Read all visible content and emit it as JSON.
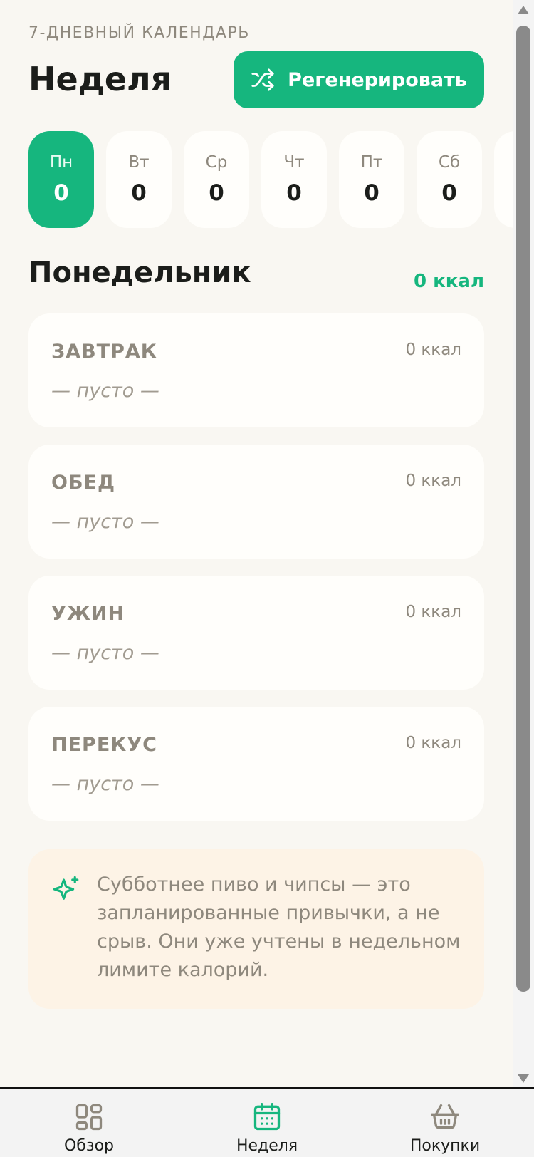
{
  "header": {
    "kicker": "7-ДНЕВНЫЙ КАЛЕНДАРЬ",
    "title": "Неделя",
    "regenerate_label": "Регенерировать"
  },
  "days": [
    {
      "label": "Пн",
      "value": "0",
      "active": true
    },
    {
      "label": "Вт",
      "value": "0"
    },
    {
      "label": "Ср",
      "value": "0"
    },
    {
      "label": "Чт",
      "value": "0"
    },
    {
      "label": "Пт",
      "value": "0"
    },
    {
      "label": "Сб",
      "value": "0"
    }
  ],
  "selected_day": {
    "title": "Понедельник",
    "total": "0 ккал"
  },
  "meals": [
    {
      "name": "ЗАВТРАК",
      "kcal": "0 ккал",
      "empty": "— пусто —"
    },
    {
      "name": "ОБЕД",
      "kcal": "0 ккал",
      "empty": "— пусто —"
    },
    {
      "name": "УЖИН",
      "kcal": "0 ккал",
      "empty": "— пусто —"
    },
    {
      "name": "ПЕРЕКУС",
      "kcal": "0 ккал",
      "empty": "— пусто —"
    }
  ],
  "tip": {
    "icon": "sparkles-icon",
    "text": "Субботнее пиво и чипсы — это запланированные привычки, а не срыв. Они уже учтены в недельном лимите калорий."
  },
  "tabbar": {
    "overview_label": "Обзор",
    "week_label": "Неделя",
    "shopping_label": "Покупки"
  },
  "colors": {
    "accent": "#16b67e",
    "background": "#f9f7f2",
    "card": "#fffefb",
    "tip_background": "#fdf3e6",
    "muted_text": "#8e887d"
  }
}
